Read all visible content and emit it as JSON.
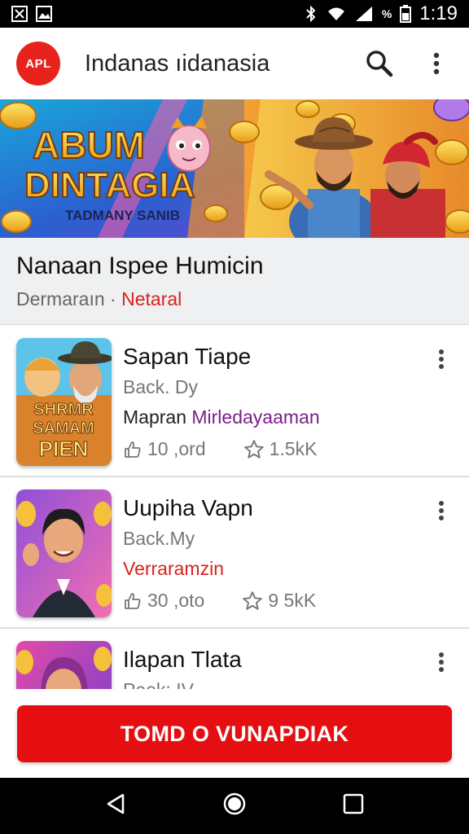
{
  "status_bar": {
    "time": "1:19",
    "battery_pct": "%"
  },
  "app_bar": {
    "logo_text": "APL",
    "title": "Indanas ıidanasia"
  },
  "banner": {
    "headline_1": "ABUM",
    "headline_2": "DINTAGIA",
    "tagline": "TADMANY SANIB"
  },
  "section": {
    "title": "Nanaan Ispee Humicin",
    "subtitle_prefix": "Dermaraın ·",
    "subtitle_tag": "Netaral",
    "tag_color": "#d8231c"
  },
  "items": [
    {
      "title": "Sapan Tiape",
      "subtitle": "Back. Dy",
      "tag_prefix": "Mapran",
      "tag": "Mirledayaaman",
      "tag_color": "#7a1f8c",
      "likes": "10 ,ord",
      "rating": "1.5kK",
      "thumb_text_1": "SHRMR",
      "thumb_text_2": "SAMAM",
      "thumb_text_3": "PIEN"
    },
    {
      "title": "Uupiha Vapn",
      "subtitle": "Back.My",
      "tag_prefix": "",
      "tag": "Verraramzin",
      "tag_color": "#d8231c",
      "likes": "30 ,oto",
      "rating": "9 5kK"
    },
    {
      "title": "Ilapan Tlata",
      "subtitle": "Peok: IV"
    }
  ],
  "cta": {
    "label": "TOMD O VUNAPDIAK"
  },
  "colors": {
    "accent": "#e50f12",
    "logo": "#e8231c"
  }
}
